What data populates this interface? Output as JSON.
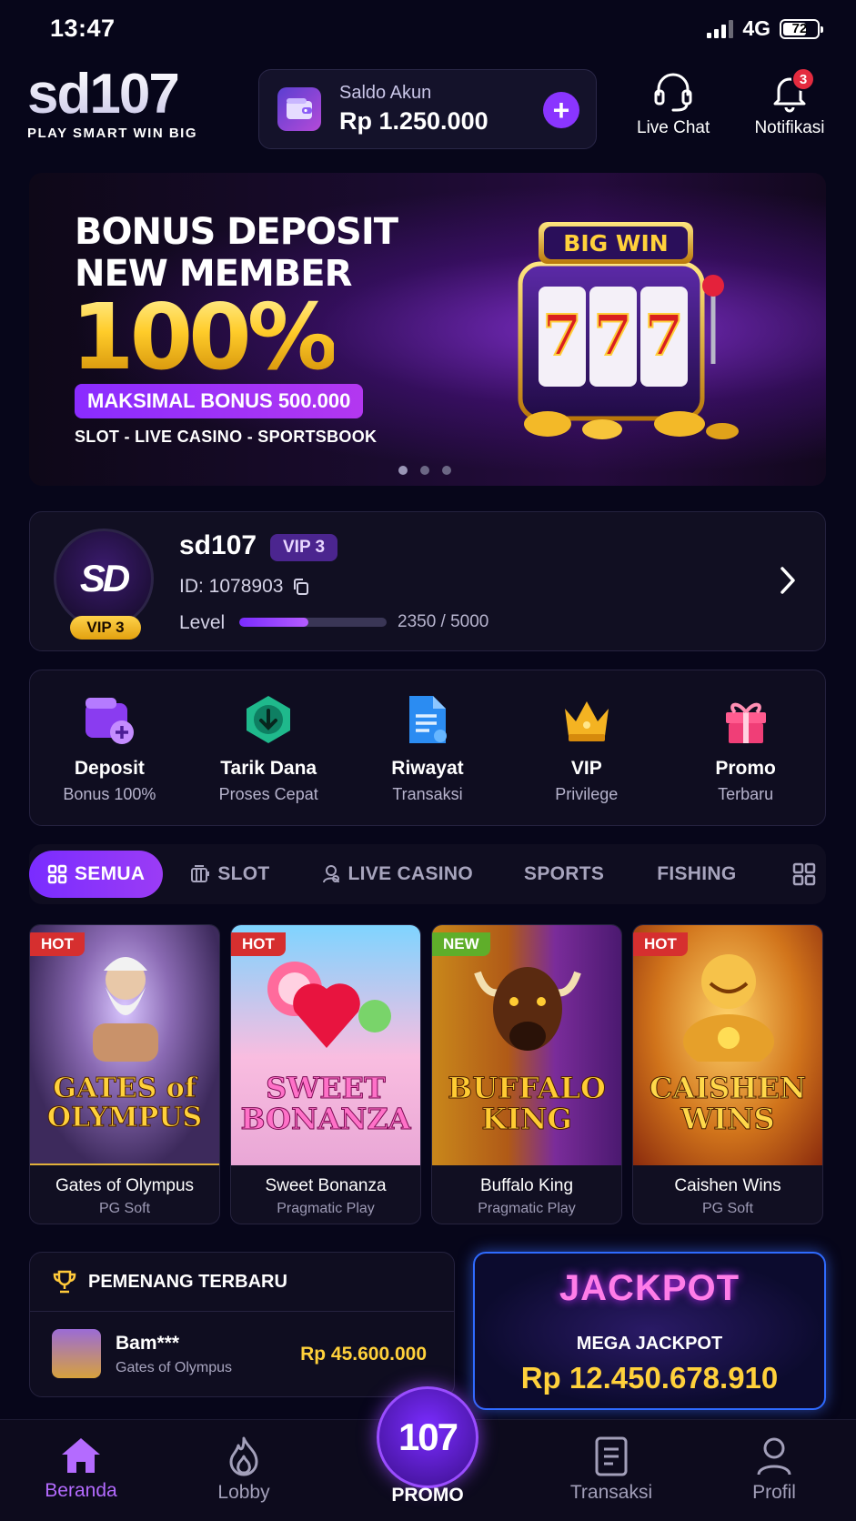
{
  "status_bar": {
    "time": "13:47",
    "network": "4G",
    "battery": "72",
    "battery_level": 0.72
  },
  "header": {
    "logo_main": "sd107",
    "logo_tagline": "PLAY SMART WIN BIG",
    "balance_label": "Saldo Akun",
    "balance_value": "Rp 1.250.000",
    "add_label": "+",
    "live_chat_label": "Live Chat",
    "notifications_label": "Notifikasi",
    "notification_count": "3"
  },
  "banner": {
    "line1": "BONUS DEPOSIT",
    "line2": "NEW MEMBER",
    "percent": "100%",
    "max_bonus": "MAKSIMAL BONUS 500.000",
    "categories": "SLOT - LIVE CASINO - SPORTSBOOK",
    "badge": "BIG WIN",
    "reels": [
      "7",
      "7",
      "7"
    ],
    "slides": 3,
    "active_slide": 1
  },
  "profile": {
    "avatar_text": "SD",
    "avatar_vip": "VIP 3",
    "username": "sd107",
    "vip_badge": "VIP 3",
    "id_text": "ID: 1078903",
    "level_label": "Level",
    "level_current": 2350,
    "level_max": 5000,
    "level_text": "2350 / 5000"
  },
  "quick_menu": [
    {
      "label": "Deposit",
      "sub": "Bonus 100%",
      "icon": "wallet-plus-icon"
    },
    {
      "label": "Tarik Dana",
      "sub": "Proses Cepat",
      "icon": "withdraw-icon"
    },
    {
      "label": "Riwayat",
      "sub": "Transaksi",
      "icon": "document-icon"
    },
    {
      "label": "VIP",
      "sub": "Privilege",
      "icon": "crown-icon"
    },
    {
      "label": "Promo",
      "sub": "Terbaru",
      "icon": "gift-icon"
    }
  ],
  "tabs": [
    {
      "label": "SEMUA",
      "active": true
    },
    {
      "label": "SLOT",
      "active": false
    },
    {
      "label": "LIVE CASINO",
      "active": false
    },
    {
      "label": "SPORTS",
      "active": false
    },
    {
      "label": "FISHING",
      "active": false
    }
  ],
  "games": [
    {
      "name": "Gates of Olympus",
      "provider": "PG Soft",
      "badge": "HOT",
      "art_title": "GATES of OLYMPUS"
    },
    {
      "name": "Sweet Bonanza",
      "provider": "Pragmatic Play",
      "badge": "HOT",
      "art_title": "SWEET BONANZA"
    },
    {
      "name": "Buffalo King",
      "provider": "Pragmatic Play",
      "badge": "NEW",
      "art_title": "BUFFALO KING"
    },
    {
      "name": "Caishen Wins",
      "provider": "PG Soft",
      "badge": "HOT",
      "art_title": "CAISHEN WINS"
    }
  ],
  "winners": {
    "title": "PEMENANG TERBARU",
    "entries": [
      {
        "user": "Bam***",
        "game": "Gates of Olympus",
        "amount": "Rp 45.600.000"
      }
    ]
  },
  "jackpot": {
    "title": "JACKPOT",
    "subtitle": "MEGA JACKPOT",
    "amount": "Rp 12.450.678.910"
  },
  "bottom_nav": {
    "home": "Beranda",
    "lobby": "Lobby",
    "promo_badge": "107",
    "promo": "PROMO",
    "transactions": "Transaksi",
    "profile": "Profil"
  },
  "colors": {
    "accent": "#8a35ff",
    "gold": "#ffd13b",
    "background": "#07061a",
    "hot": "#d62f2f",
    "new": "#5fae2a"
  }
}
